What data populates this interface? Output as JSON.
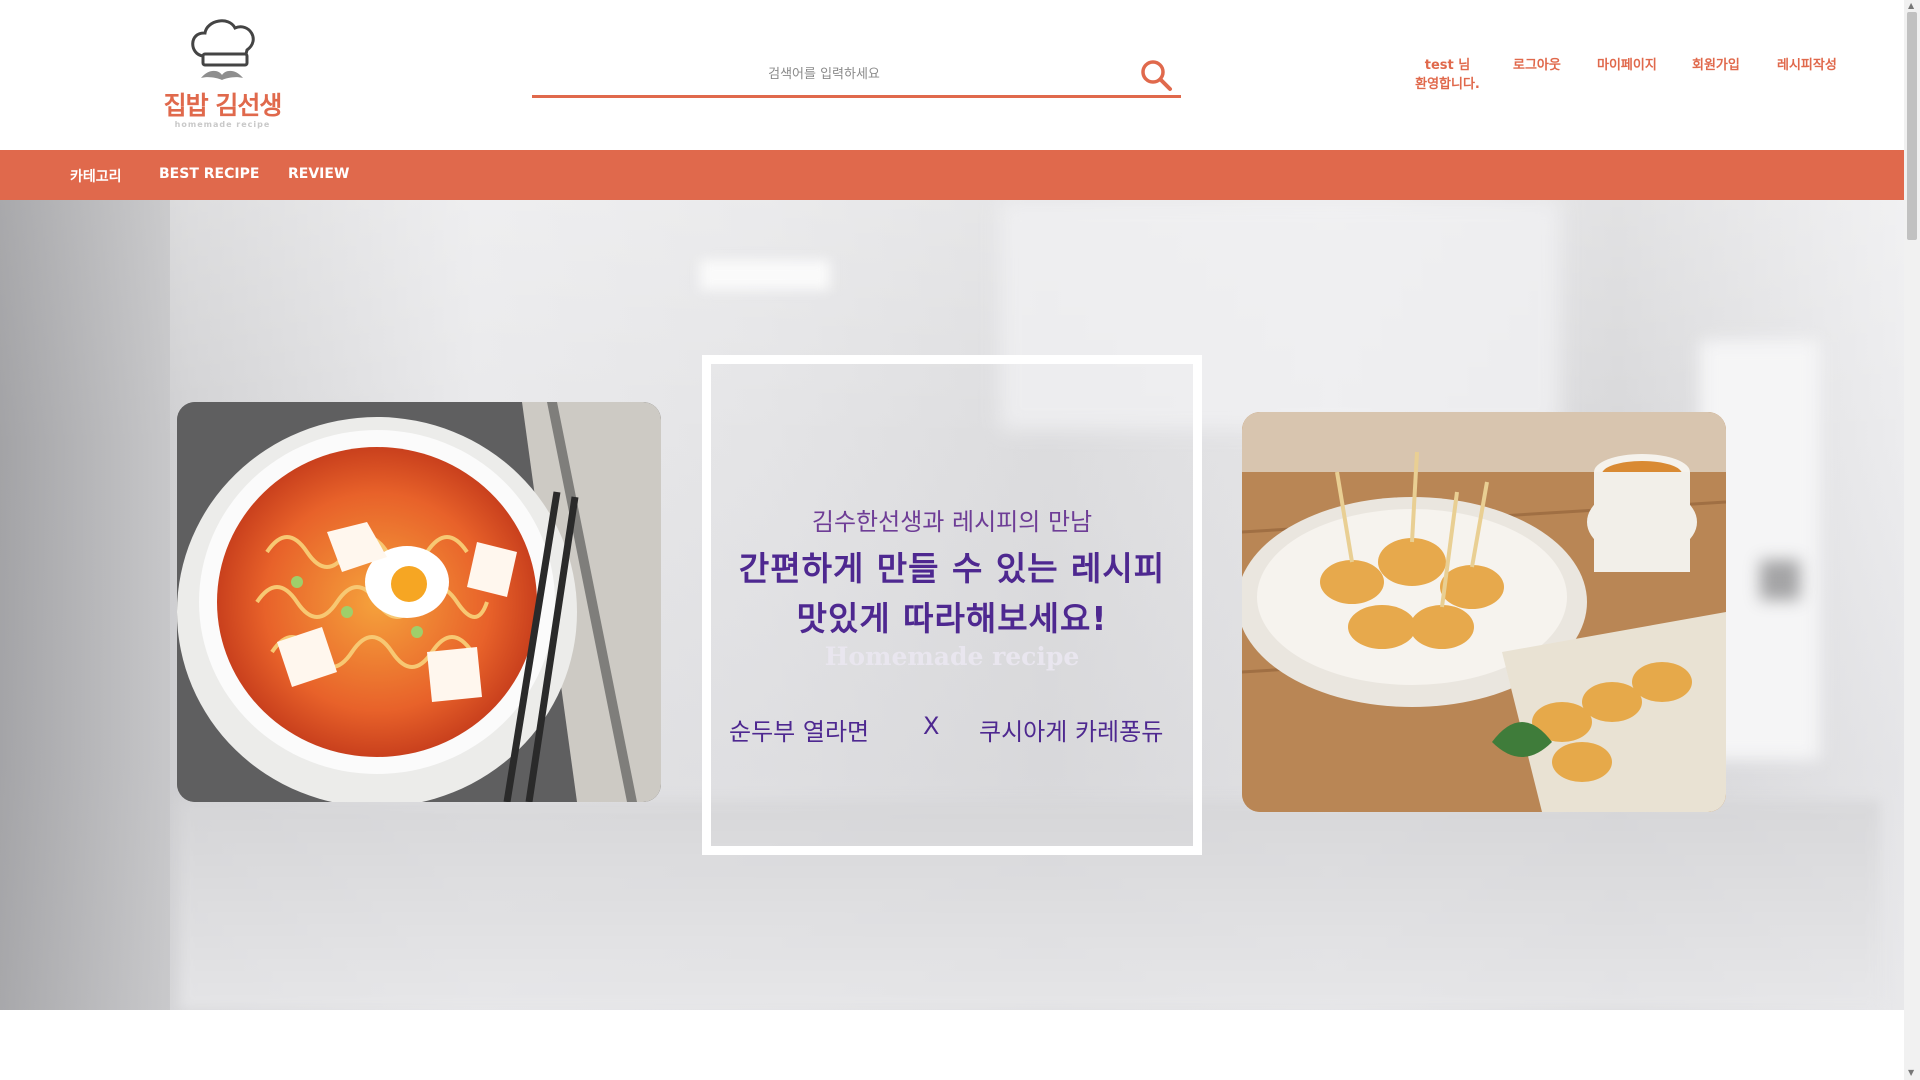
{
  "brand": {
    "name": "집밥 김선생",
    "tagline": "homemade recipe",
    "accent": "#e0694c"
  },
  "search": {
    "placeholder": "검색어를 입력하세요",
    "icon": "search-icon"
  },
  "user_nav": {
    "welcome_line1": "test 님",
    "welcome_line2": "환영합니다.",
    "links": [
      "로그아웃",
      "마이페이지",
      "회원가입",
      "레시피작성"
    ]
  },
  "category_bar": {
    "items": [
      "카테고리",
      "BEST RECIPE",
      "REVIEW"
    ]
  },
  "hero": {
    "left_image": "ramen-bowl-photo",
    "right_image": "fried-skewers-photo",
    "card": {
      "line1": "김수한선생과 레시피의 만남",
      "line2": "간편하게 만들 수 있는 레시피",
      "line3": "맛있게 따라해보세요!",
      "line4": "Homemade recipe",
      "dish_left": "순두부 열라면",
      "separator": "X",
      "dish_right": "쿠시아게 카레퐁듀",
      "text_color": "#4e2890"
    }
  }
}
